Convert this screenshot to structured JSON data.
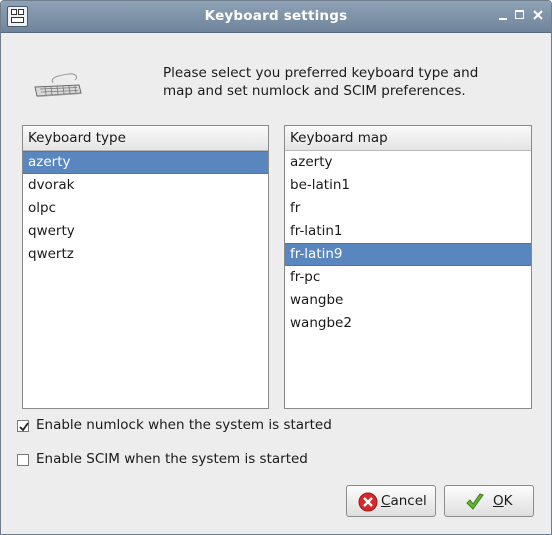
{
  "window": {
    "title": "Keyboard settings",
    "controls": [
      "minimize-icon",
      "maximize-icon",
      "close-icon"
    ]
  },
  "header": {
    "icon": "keyboard-icon",
    "intro_line1": "Please select you preferred keyboard type and",
    "intro_line2": "map and set numlock and SCIM preferences."
  },
  "keyboard_type": {
    "header": "Keyboard type",
    "items": [
      "azerty",
      "dvorak",
      "olpc",
      "qwerty",
      "qwertz"
    ],
    "selected": "azerty"
  },
  "keyboard_map": {
    "header": "Keyboard map",
    "items": [
      "azerty",
      "be-latin1",
      "fr",
      "fr-latin1",
      "fr-latin9",
      "fr-pc",
      "wangbe",
      "wangbe2"
    ],
    "selected": "fr-latin9"
  },
  "options": {
    "numlock_label": "Enable numlock when the system is started",
    "numlock_checked": true,
    "scim_label": "Enable SCIM when the system is started",
    "scim_checked": false
  },
  "buttons": {
    "cancel_mnemonic": "C",
    "cancel_rest": "ancel",
    "cancel_icon": "cancel-icon",
    "ok_mnemonic": "O",
    "ok_rest": "K",
    "ok_icon": "checkmark-icon"
  },
  "colors": {
    "selection": "#5a86bf",
    "titlebar": "#7a8ea4"
  }
}
